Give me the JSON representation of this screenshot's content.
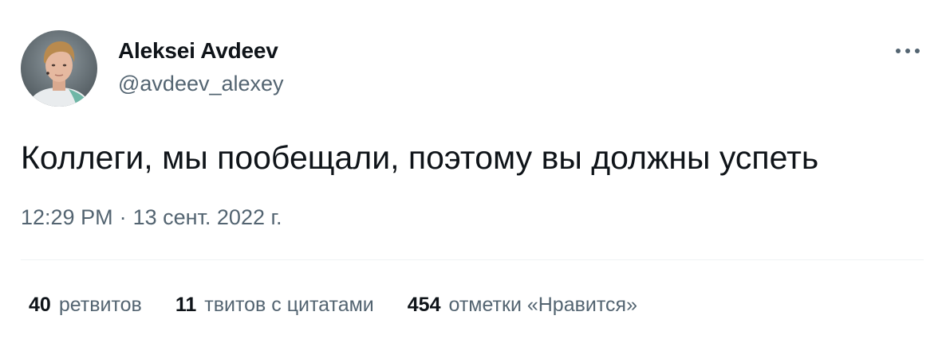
{
  "author": {
    "display_name": "Aleksei Avdeev",
    "handle": "@avdeev_alexey",
    "avatar_icon": "profile-photo"
  },
  "tweet": {
    "text": "Коллеги, мы пообещали, поэтому вы должны успеть",
    "time": "12:29 PM",
    "separator": "·",
    "date": "13 сент. 2022 г."
  },
  "stats": [
    {
      "count": "40",
      "label": "ретвитов"
    },
    {
      "count": "11",
      "label": "твитов с цитатами"
    },
    {
      "count": "454",
      "label": "отметки «Нравится»"
    }
  ],
  "colors": {
    "text_primary": "#0f1419",
    "text_secondary": "#536471",
    "divider": "#eff3f4"
  }
}
